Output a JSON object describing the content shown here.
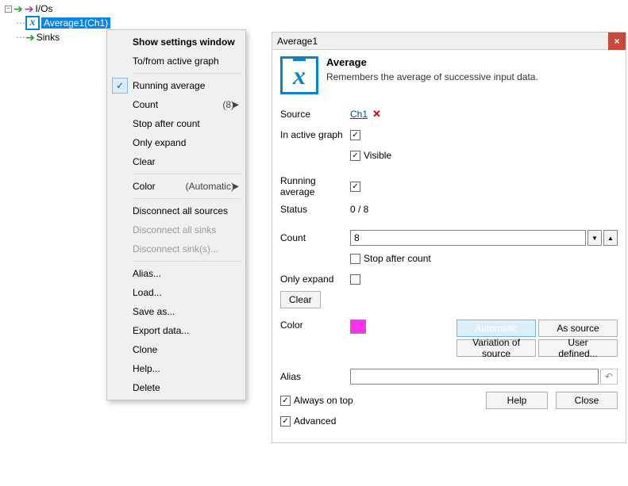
{
  "tree": {
    "root": "I/Os",
    "avg_node": "Average1(Ch1)",
    "sinks": "Sinks"
  },
  "ctx": {
    "show": "Show settings window",
    "tofrom": "To/from active graph",
    "running": "Running average",
    "count": "Count",
    "count_val": "(8)",
    "stop": "Stop after count",
    "only": "Only expand",
    "clear": "Clear",
    "color": "Color",
    "color_val": "(Automatic)",
    "disc_src": "Disconnect all sources",
    "disc_snk": "Disconnect all sinks",
    "disc_sel": "Disconnect sink(s)...",
    "alias": "Alias...",
    "load": "Load...",
    "save": "Save as...",
    "export": "Export data...",
    "clone": "Clone",
    "help": "Help...",
    "delete": "Delete"
  },
  "panel": {
    "title": "Average1",
    "heading": "Average",
    "subtitle": "Remembers the average of successive input data.",
    "lbl_source": "Source",
    "source_link": "Ch1",
    "lbl_active": "In active graph",
    "lbl_visible": "Visible",
    "lbl_running": "Running average",
    "lbl_status": "Status",
    "status_val": "0 / 8",
    "lbl_count": "Count",
    "count_val": "8",
    "lbl_stopafter": "Stop after count",
    "lbl_only": "Only expand",
    "btn_clear": "Clear",
    "lbl_color": "Color",
    "btn_auto": "Automatic",
    "btn_assrc": "As source",
    "btn_varsrc": "Variation of source",
    "btn_user": "User defined...",
    "lbl_alias": "Alias",
    "lbl_ontop": "Always on top",
    "lbl_adv": "Advanced",
    "btn_help": "Help",
    "btn_close": "Close",
    "color_swatch": "#ff2ff3"
  }
}
